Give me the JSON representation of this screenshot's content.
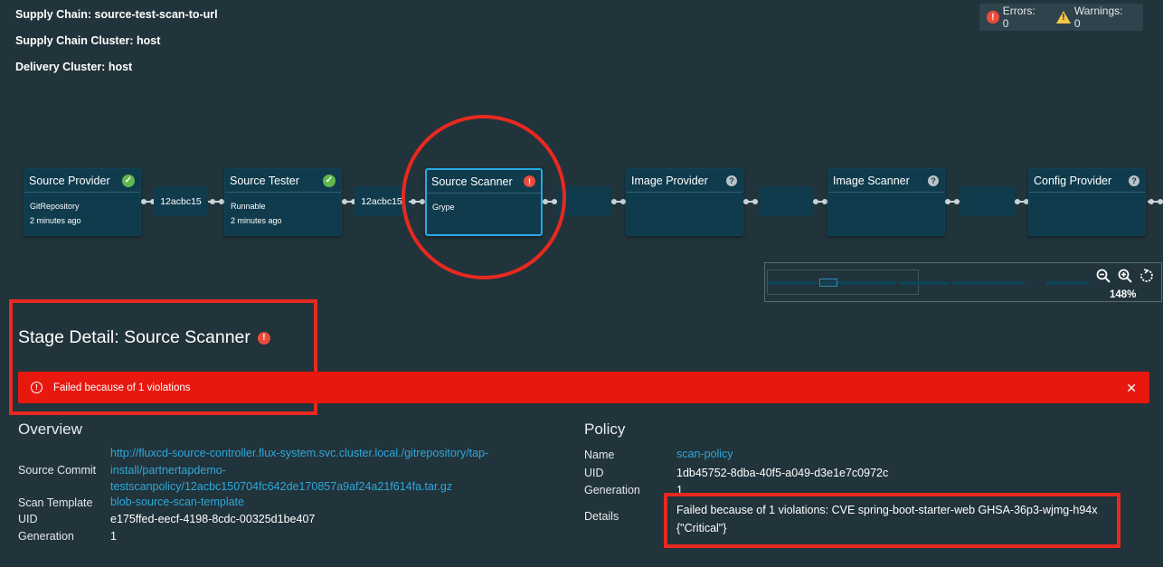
{
  "header": {
    "supply_chain": "Supply Chain: source-test-scan-to-url",
    "supply_chain_cluster": "Supply Chain Cluster: host",
    "delivery_cluster": "Delivery Cluster: host"
  },
  "status": {
    "errors": "Errors: 0",
    "warnings": "Warnings: 0"
  },
  "graph": {
    "nodes": [
      {
        "title": "Source Provider",
        "line1": "GitRepository",
        "line2": "2 minutes ago",
        "status": "success"
      },
      {
        "title": "Source Tester",
        "line1": "Runnable",
        "line2": "2 minutes ago",
        "status": "success"
      },
      {
        "title": "Source Scanner",
        "line1": "Grype",
        "line2": "",
        "status": "error",
        "selected": true
      },
      {
        "title": "Image Provider",
        "line1": "",
        "line2": "",
        "status": "unknown"
      },
      {
        "title": "Image Scanner",
        "line1": "",
        "line2": "",
        "status": "unknown"
      },
      {
        "title": "Config Provider",
        "line1": "",
        "line2": "",
        "status": "unknown"
      }
    ],
    "connectors": [
      "12acbc15",
      "12acbc15",
      "",
      "",
      ""
    ],
    "zoom_level": "148%"
  },
  "stage": {
    "title": "Stage Detail: Source Scanner",
    "alert": "Failed because of 1 violations"
  },
  "overview": {
    "heading": "Overview",
    "source_commit_label": "Source Commit",
    "source_commit_line1": "http://fluxcd-source-controller.flux-system.svc.cluster.local./gitrepository/tap-",
    "source_commit_line2": "install/partnertapdemo-",
    "source_commit_line3": "testscanpolicy/12acbc150704fc642de170857a9af24a21f614fa.tar.gz",
    "scan_template_label": "Scan Template",
    "scan_template": "blob-source-scan-template",
    "uid_label": "UID",
    "uid": "e175ffed-eecf-4198-8cdc-00325d1be407",
    "generation_label": "Generation",
    "generation": "1"
  },
  "policy": {
    "heading": "Policy",
    "name_label": "Name",
    "name": "scan-policy",
    "uid_label": "UID",
    "uid": "1db45752-8dba-40f5-a049-d3e1e7c0972c",
    "generation_label": "Generation",
    "generation": "1",
    "details_label": "Details",
    "details_line1": "Failed because of 1 violations: CVE spring-boot-starter-web GHSA-36p3-wjmg-h94x",
    "details_line2": "{\"Critical\"}"
  },
  "colors": {
    "background": "#21333b",
    "node": "#0f3b4d",
    "accent": "#27a9e1",
    "error": "#e8180f",
    "link": "#2ea8d9"
  }
}
